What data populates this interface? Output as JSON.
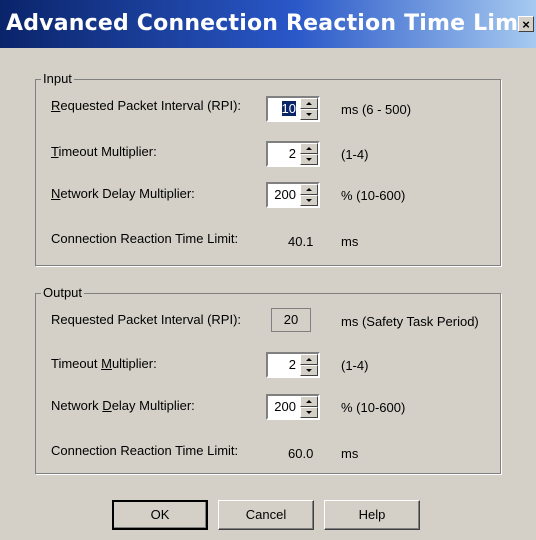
{
  "window": {
    "title": "Advanced Connection Reaction Time Lim...",
    "close_label": "×"
  },
  "input": {
    "legend": "Input",
    "rpi_label": "Requested Packet Interval (RPI):",
    "rpi_value": "10",
    "rpi_range": "ms (6 - 500)",
    "timeout_label": "Timeout Multiplier:",
    "timeout_value": "2",
    "timeout_range": "(1-4)",
    "delay_label": "Network Delay Multiplier:",
    "delay_value": "200",
    "delay_range": "% (10-600)",
    "limit_label": "Connection Reaction Time Limit:",
    "limit_value": "40.1",
    "limit_unit": "ms"
  },
  "output": {
    "legend": "Output",
    "rpi_label": "Requested Packet Interval (RPI):",
    "rpi_value": "20",
    "rpi_range": "ms (Safety Task Period)",
    "timeout_label": "Timeout Multiplier:",
    "timeout_value": "2",
    "timeout_range": "(1-4)",
    "delay_label": "Network Delay Multiplier:",
    "delay_value": "200",
    "delay_range": "% (10-600)",
    "limit_label": "Connection Reaction Time Limit:",
    "limit_value": "60.0",
    "limit_unit": "ms"
  },
  "buttons": {
    "ok": "OK",
    "cancel": "Cancel",
    "help": "Help"
  }
}
